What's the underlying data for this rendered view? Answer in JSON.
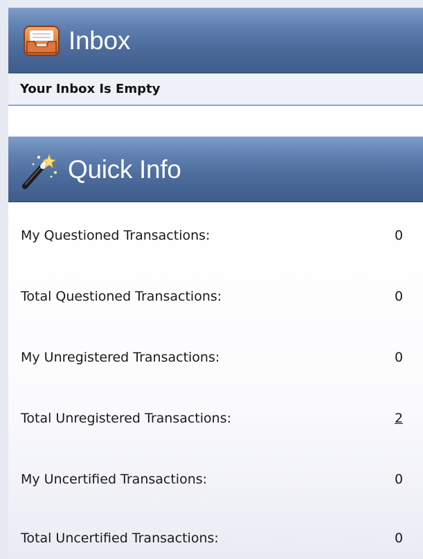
{
  "inbox": {
    "title": "Inbox",
    "icon": "inbox-tray-icon",
    "message": "Your Inbox Is Empty"
  },
  "quick_info": {
    "title": "Quick Info",
    "icon": "magic-wand-icon",
    "rows": [
      {
        "label": "My Questioned Transactions:",
        "value": "0"
      },
      {
        "label": "Total Questioned Transactions:",
        "value": "0"
      },
      {
        "label": "My Unregistered Transactions:",
        "value": "0"
      },
      {
        "label": "Total Unregistered Transactions:",
        "value": "2"
      },
      {
        "label": "My Uncertified Transactions:",
        "value": "0"
      },
      {
        "label": "Total Uncertified Transactions:",
        "value": "0"
      }
    ]
  },
  "colors": {
    "header_gradient_top": "#7d9cc8",
    "header_gradient_bottom": "#3e5d8b",
    "page_background": "#e8eaf4",
    "header_text": "#ffffff"
  }
}
